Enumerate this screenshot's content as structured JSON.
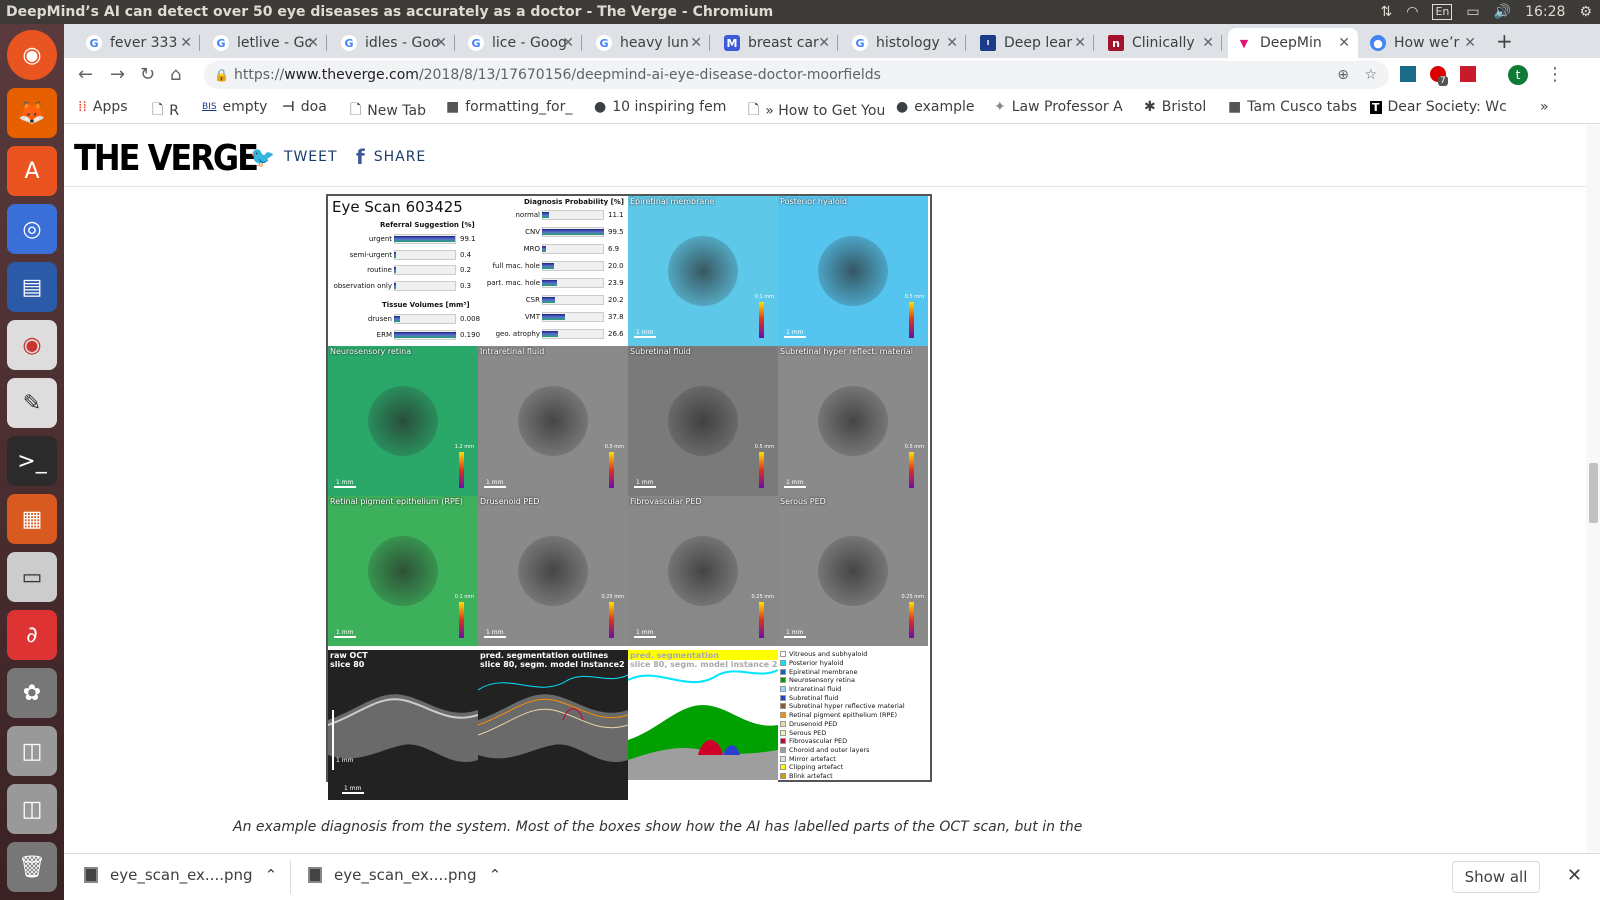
{
  "os": {
    "window_title": "DeepMind’s AI can detect over 50 eye diseases as accurately as a doctor - The Verge - Chromium",
    "kbd": "En",
    "clock": "16:28"
  },
  "tabs": [
    {
      "title": "fever 333",
      "icon": "google-icon",
      "active": false
    },
    {
      "title": "letlive - Go",
      "icon": "google-icon",
      "active": false
    },
    {
      "title": "idles - Goo",
      "icon": "google-icon",
      "active": false
    },
    {
      "title": "lice - Goog",
      "icon": "google-icon",
      "active": false
    },
    {
      "title": "heavy lun",
      "icon": "google-icon",
      "active": false
    },
    {
      "title": "breast car",
      "icon": "mendeley-icon",
      "active": false
    },
    {
      "title": "histology",
      "icon": "google-icon",
      "active": false
    },
    {
      "title": "Deep lear",
      "icon": "ieee-icon",
      "active": false
    },
    {
      "title": "Clinically",
      "icon": "nejm-icon",
      "active": false
    },
    {
      "title": "DeepMin",
      "icon": "verge-icon",
      "active": true
    },
    {
      "title": "How we’r",
      "icon": "chrome-icon",
      "active": false
    }
  ],
  "url": {
    "prefix": "https://",
    "host": "www.theverge.com",
    "path": "/2018/8/13/17670156/deepmind-ai-eye-disease-doctor-moorfields"
  },
  "bookmarks": [
    "Apps",
    "R",
    "empty",
    "doa",
    "New Tab",
    "formatting_for_",
    "10 inspiring fem",
    "» How to Get You",
    "example",
    "Law Professor A",
    "Bristol",
    "Tam Cusco tabs",
    "Dear Society: Wc"
  ],
  "bookmark_icons": {
    "bis": "BIS",
    "more": "»",
    "badge": "7",
    "avatar": "t"
  },
  "verge": {
    "logo": "THE VERGE",
    "tweet": "TWEET",
    "share": "SHARE"
  },
  "figure": {
    "title": "Eye Scan 603425",
    "referral_heading": "Referral Suggestion [%]",
    "referral": [
      {
        "label": "urgent",
        "value": "99.1",
        "pct": 0.991
      },
      {
        "label": "semi-urgent",
        "value": "0.4",
        "pct": 0.004
      },
      {
        "label": "routine",
        "value": "0.2",
        "pct": 0.002
      },
      {
        "label": "observation only",
        "value": "0.3",
        "pct": 0.003
      }
    ],
    "tissue_heading": "Tissue Volumes [mm³]",
    "tissue": [
      {
        "label": "drusen",
        "value": "0.008",
        "pct": 0.1
      },
      {
        "label": "ERM",
        "value": "0.190",
        "pct": 1.0
      }
    ],
    "diag_heading": "Diagnosis Probability [%]",
    "diagnosis": [
      {
        "label": "normal",
        "value": "11.1",
        "pct": 0.111
      },
      {
        "label": "CNV",
        "value": "99.5",
        "pct": 0.995
      },
      {
        "label": "MRO",
        "value": "6.9",
        "pct": 0.069
      },
      {
        "label": "full mac. hole",
        "value": "20.0",
        "pct": 0.2
      },
      {
        "label": "part. mac. hole",
        "value": "23.9",
        "pct": 0.239
      },
      {
        "label": "CSR",
        "value": "20.2",
        "pct": 0.202
      },
      {
        "label": "VMT",
        "value": "37.8",
        "pct": 0.378
      },
      {
        "label": "geo. atrophy",
        "value": "26.6",
        "pct": 0.266
      }
    ],
    "panels": [
      {
        "label": "Epiretinal membrane",
        "bg": "#5ec8e8",
        "cbar": "0.1 mm"
      },
      {
        "label": "Posterior hyaloid",
        "bg": "#55c4ee",
        "cbar": "0.5 mm"
      },
      {
        "label": "Neurosensory retina",
        "bg": "#2aa86a",
        "cbar": "1.2 mm"
      },
      {
        "label": "Intraretinal fluid",
        "bg": "#8a8a8a",
        "cbar": "0.5 mm"
      },
      {
        "label": "Subretinal fluid",
        "bg": "#7a7a7a",
        "cbar": "0.5 mm"
      },
      {
        "label": "Subretinal hyper reflect. material",
        "bg": "#8a8a8a",
        "cbar": "0.5 mm"
      },
      {
        "label": "Retinal pigment epithelium (RPE)",
        "bg": "#3cb05a",
        "cbar": "0.1 mm"
      },
      {
        "label": "Drusenoid PED",
        "bg": "#8a8a8a",
        "cbar": "0.25 mm"
      },
      {
        "label": "Fibrovascular PED",
        "bg": "#888888",
        "cbar": "0.25 mm"
      },
      {
        "label": "Serous PED",
        "bg": "#8a8a8a",
        "cbar": "0.25 mm"
      }
    ],
    "scale_label": "1 mm",
    "cbar_min": "0 mm",
    "oct": [
      {
        "label": "raw OCT\nslice 80"
      },
      {
        "label": "pred. segmentation outlines\nslice 80, segm. model instance2"
      },
      {
        "label": "pred. segmentation\nslice 80, segm. model instance 2"
      }
    ],
    "legend": [
      {
        "label": "Vitreous and subhyaloid",
        "color": "#ffffff"
      },
      {
        "label": "Posterior hyaloid",
        "color": "#00e5ff"
      },
      {
        "label": "Epiretinal membrane",
        "color": "#1565c0"
      },
      {
        "label": "Neurosensory retina",
        "color": "#00a000"
      },
      {
        "label": "Intraretinal fluid",
        "color": "#9fd3ff"
      },
      {
        "label": "Subretinal fluid",
        "color": "#2a3fd0"
      },
      {
        "label": "Subretinal hyper reflective material",
        "color": "#8d5a2b"
      },
      {
        "label": "Retinal pigment epithelium (RPE)",
        "color": "#ff8c00"
      },
      {
        "label": "Drusenoid PED",
        "color": "#e9d9a8"
      },
      {
        "label": "Serous PED",
        "color": "#f4f0b0"
      },
      {
        "label": "Fibrovascular PED",
        "color": "#d0002a"
      },
      {
        "label": "Choroid and outer layers",
        "color": "#9e9e9e"
      },
      {
        "label": "Mirror artefact",
        "color": "#e0e0e0"
      },
      {
        "label": "Clipping artefact",
        "color": "#ffff00"
      },
      {
        "label": "Blink artefact",
        "color": "#c8a000"
      }
    ]
  },
  "caption": "An example diagnosis from the system. Most of the boxes show how the AI has labelled parts of the OCT scan, but in the",
  "downloads": [
    {
      "name": "eye_scan_ex....png"
    },
    {
      "name": "eye_scan_ex....png"
    }
  ],
  "show_all": "Show all"
}
